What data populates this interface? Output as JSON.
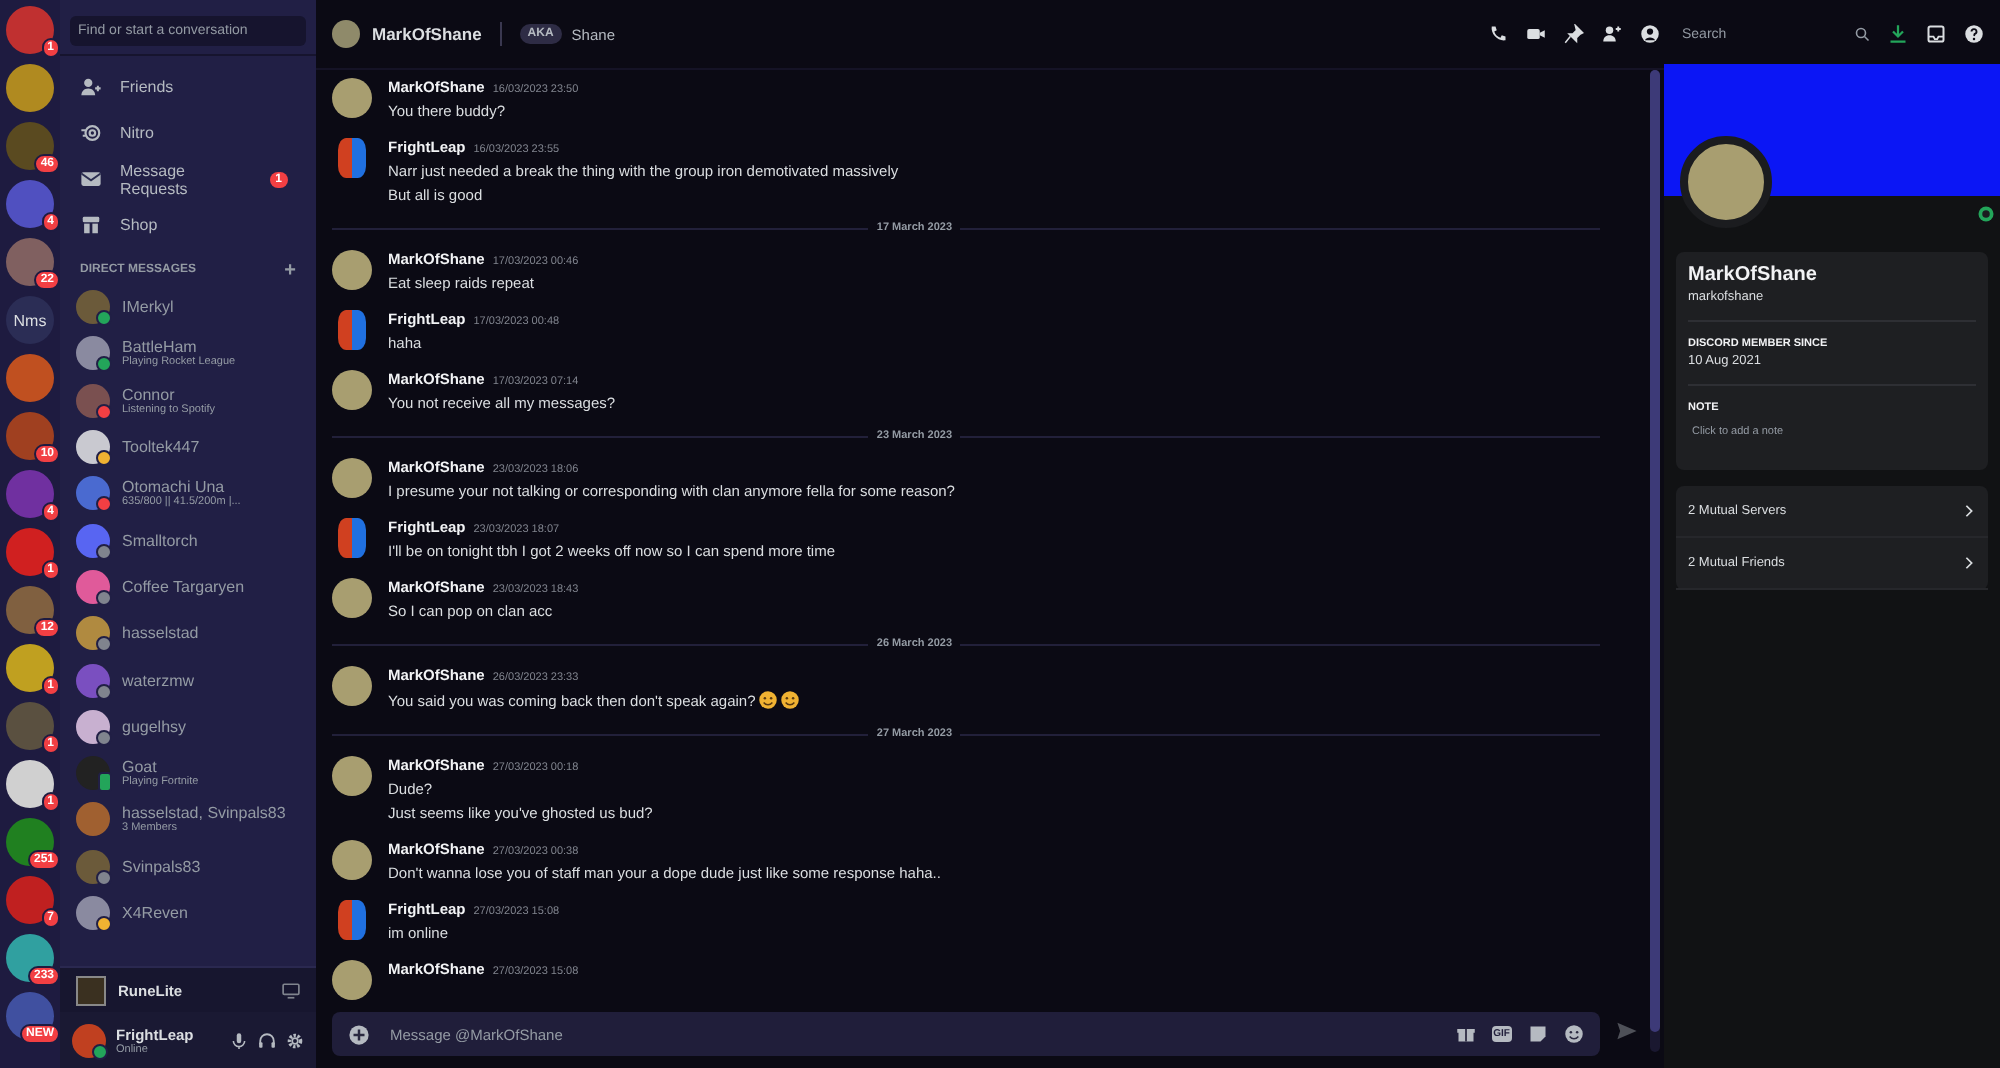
{
  "servers": [
    {
      "kind": "image",
      "badge": "1"
    },
    {
      "kind": "image"
    },
    {
      "kind": "image",
      "badge": "46"
    },
    {
      "kind": "image",
      "badge": "4"
    },
    {
      "kind": "image",
      "badge": "22"
    },
    {
      "kind": "text",
      "label": "Nms"
    },
    {
      "kind": "image"
    },
    {
      "kind": "image",
      "badge": "10"
    },
    {
      "kind": "image",
      "badge": "4"
    },
    {
      "kind": "image",
      "badge": "1"
    },
    {
      "kind": "image",
      "badge": "12"
    },
    {
      "kind": "image",
      "badge": "1"
    },
    {
      "kind": "image",
      "badge": "1"
    },
    {
      "kind": "image",
      "badge": "1"
    },
    {
      "kind": "image",
      "badge": "251"
    },
    {
      "kind": "image",
      "badge": "7"
    },
    {
      "kind": "image",
      "badge": "233"
    },
    {
      "kind": "image",
      "badge": "NEW"
    }
  ],
  "search": {
    "placeholder": "Find or start a conversation"
  },
  "nav": [
    {
      "kind": "friends",
      "label": "Friends"
    },
    {
      "kind": "nitro",
      "label": "Nitro"
    },
    {
      "kind": "requests",
      "label": "Message Requests",
      "badge": "1"
    },
    {
      "kind": "shop",
      "label": "Shop"
    }
  ],
  "dm_header": {
    "title": "DIRECT MESSAGES",
    "add": "+"
  },
  "dms": [
    {
      "name": "IMerkyl",
      "color": "#23a55a"
    },
    {
      "name": "BattleHam",
      "color": "#23a55a",
      "subtitle": "Playing Rocket League"
    },
    {
      "name": "Connor",
      "color": "#f23f43",
      "subtitle": "Listening to Spotify"
    },
    {
      "name": "Tooltek447",
      "color": "#f0b232"
    },
    {
      "name": "Otomachi Una",
      "color": "#f23f43",
      "subtitle": "635/800 || 41.5/200m |..."
    },
    {
      "name": "Smalltorch",
      "color": "#80848e"
    },
    {
      "name": "Coffee Targaryen",
      "color": "#80848e"
    },
    {
      "name": "hasselstad",
      "color": "#80848e"
    },
    {
      "name": "waterzmw",
      "color": "#80848e"
    },
    {
      "name": "gugelhsy",
      "color": "#80848e"
    },
    {
      "name": "Goat",
      "color": "#23a55a",
      "mobile": true,
      "subtitle": "Playing Fortnite"
    },
    {
      "name": "hasselstad, Svinpals83",
      "subtitle": "3 Members"
    },
    {
      "name": "Svinpals83",
      "color": "#80848e"
    },
    {
      "name": "X4Reven",
      "color": "#f0b232"
    }
  ],
  "activity": {
    "title": "RuneLite"
  },
  "user": {
    "name": "FrightLeap",
    "status_text": "Online",
    "color": "#23a55a"
  },
  "chat_header": {
    "name": "MarkOfShane",
    "aka": "AKA",
    "nickname": "Shane",
    "search_placeholder": "Search"
  },
  "messages": [
    {
      "kind": "contact_message",
      "author": "MarkOfShane",
      "time": "16/03/2023 23:50",
      "lines": [
        "You there buddy?"
      ]
    },
    {
      "kind": "own_message",
      "author": "FrightLeap",
      "time": "16/03/2023 23:55",
      "lines": [
        "Narr just needed a break the thing with the group iron demotivated massively",
        "But all is good"
      ]
    },
    {
      "kind": "date",
      "text": "17 March 2023"
    },
    {
      "kind": "contact_message",
      "author": "MarkOfShane",
      "time": "17/03/2023 00:46",
      "lines": [
        "Eat sleep raids repeat"
      ]
    },
    {
      "kind": "own_message",
      "author": "FrightLeap",
      "time": "17/03/2023 00:48",
      "lines": [
        "haha"
      ]
    },
    {
      "kind": "contact_message",
      "author": "MarkOfShane",
      "time": "17/03/2023 07:14",
      "lines": [
        "You not receive all my messages?"
      ]
    },
    {
      "kind": "date",
      "text": "23 March 2023"
    },
    {
      "kind": "contact_message",
      "author": "MarkOfShane",
      "time": "23/03/2023 18:06",
      "lines": [
        "I presume your not talking or corresponding with clan anymore fella for some reason?"
      ]
    },
    {
      "kind": "own_message",
      "author": "FrightLeap",
      "time": "23/03/2023 18:07",
      "lines": [
        "I'll be on tonight tbh I got 2 weeks off now so I can spend more time"
      ]
    },
    {
      "kind": "contact_message",
      "author": "MarkOfShane",
      "time": "23/03/2023 18:43",
      "lines": [
        "So I can pop on clan acc"
      ]
    },
    {
      "kind": "date",
      "text": "26 March 2023"
    },
    {
      "kind": "contact_message",
      "author": "MarkOfShane",
      "time": "26/03/2023 23:33",
      "lines": [
        "You said you was coming back then don't speak again?"
      ],
      "has_emoji": true
    },
    {
      "kind": "date",
      "text": "27 March 2023"
    },
    {
      "kind": "contact_message",
      "author": "MarkOfShane",
      "time": "27/03/2023 00:18",
      "lines": [
        "Dude?",
        "Just seems like you've ghosted us bud?"
      ]
    },
    {
      "kind": "contact_message",
      "author": "MarkOfShane",
      "time": "27/03/2023 00:38",
      "lines": [
        "Don't wanna lose you of staff man your a dope dude just like some response haha.."
      ]
    },
    {
      "kind": "own_message",
      "author": "FrightLeap",
      "time": "27/03/2023 15:08",
      "lines": [
        "im online"
      ]
    },
    {
      "kind": "contact_message",
      "author": "MarkOfShane",
      "time": "27/03/2023 15:08"
    }
  ],
  "composer": {
    "placeholder": "Message @MarkOfShane",
    "gif": "GIF"
  },
  "profile": {
    "name": "MarkOfShane",
    "username": "markofshane",
    "member_since_label": "DISCORD MEMBER SINCE",
    "member_since": "10 Aug 2021",
    "note_label": "NOTE",
    "note_placeholder": "Click to add a note",
    "links": [
      "2 Mutual Servers",
      "2 Mutual Friends"
    ]
  }
}
